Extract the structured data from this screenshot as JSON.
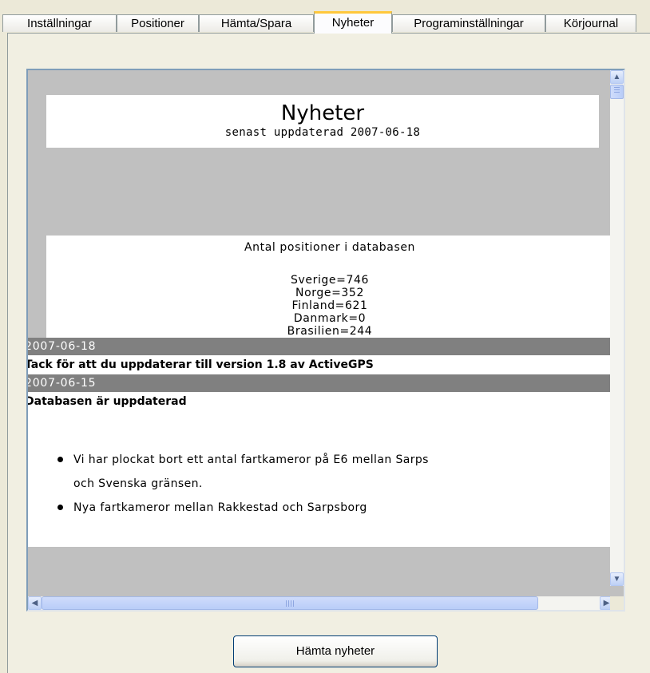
{
  "tabs": [
    {
      "label": "Inställningar"
    },
    {
      "label": "Positioner"
    },
    {
      "label": "Hämta/Spara"
    },
    {
      "label": "Nyheter",
      "active": true
    },
    {
      "label": "Programinställningar"
    },
    {
      "label": "Körjournal"
    }
  ],
  "news": {
    "title": "Nyheter",
    "updated": "senast uppdaterad 2007-06-18",
    "count_title": "Antal positioner i databasen",
    "counts": [
      "Sverige=746",
      "Norge=352",
      "Finland=621",
      "Danmark=0",
      "Brasilien=244"
    ],
    "entries": [
      {
        "date": "2007-06-18",
        "headline": "Tack för att du uppdaterar till version 1.8 av ActiveGPS"
      },
      {
        "date": "2007-06-15",
        "headline": "Databasen är uppdaterad"
      }
    ],
    "bullets": [
      "Vi har plockat bort ett antal fartkameror på E6 mellan Sarps",
      "och Svenska gränsen.",
      "Nya fartkameror mellan Rakkestad och Sarpsborg"
    ]
  },
  "scroll_icons": {
    "up": "arrow-up-icon",
    "down": "arrow-down-icon",
    "left": "arrow-left-icon",
    "right": "arrow-right-icon"
  },
  "fetch_button": "Hämta nyheter",
  "colors": {
    "tab_active_accent": "#ffc83c",
    "date_bar": "#808080",
    "scroll_blue": "#c1d3fb",
    "panel_bg": "#f1efe2"
  }
}
